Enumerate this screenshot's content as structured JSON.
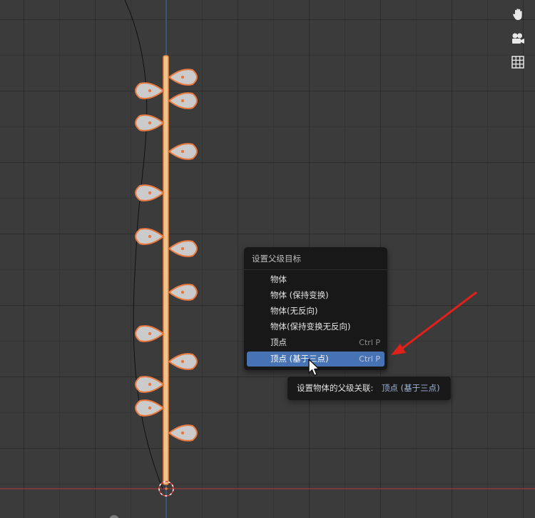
{
  "viewport": {
    "colors": {
      "background": "#3b3b3b",
      "x_axis": "#8c3a3a",
      "y_axis": "#3f5e8f",
      "stem_fill": "#f2c38c",
      "stem_outline": "#e9823a",
      "leaf_fill": "#c9c9c9",
      "leaf_outline": "#e9783e",
      "annotation": "#e0201a"
    },
    "nav_icons": [
      "hand-icon",
      "camera-icon",
      "grid-icon"
    ]
  },
  "menu": {
    "title": "设置父级目标",
    "items": [
      {
        "label": "物体",
        "shortcut": ""
      },
      {
        "label": "物体 (保持变换)",
        "shortcut": ""
      },
      {
        "label": "物体(无反向)",
        "shortcut": ""
      },
      {
        "label": "物体(保持变换无反向)",
        "shortcut": ""
      },
      {
        "label": "顶点",
        "shortcut": "Ctrl P"
      },
      {
        "label": "顶点 (基于三点)",
        "shortcut": "Ctrl P",
        "active": true
      }
    ]
  },
  "tooltip": {
    "prefix": "设置物体的父级关联:",
    "value": "顶点 (基于三点)"
  }
}
